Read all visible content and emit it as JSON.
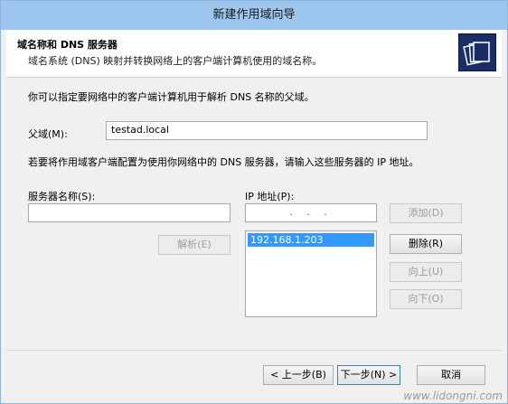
{
  "window": {
    "title": "新建作用域向导"
  },
  "header": {
    "title": "域名称和 DNS 服务器",
    "subtitle": "域名系统 (DNS) 映射并转换网络上的客户端计算机使用的域名称。",
    "icon": "folder-wizard-icon"
  },
  "intro_text": "你可以指定要网络中的客户端计算机用于解析 DNS 名称的父域。",
  "parent_domain": {
    "label": "父域(M):",
    "value": "testad.local"
  },
  "dns_instruction": "若要将作用域客户端配置为使用你网络中的 DNS 服务器，请输入这些服务器的 IP 地址。",
  "server_name": {
    "label": "服务器名称(S):",
    "value": ""
  },
  "resolve_button": "解析(E)",
  "ip": {
    "label": "IP 地址(P):",
    "input_placeholder": ". . .",
    "list": [
      "192.168.1.203"
    ]
  },
  "side_buttons": {
    "add": "添加(D)",
    "remove": "删除(R)",
    "up": "向上(U)",
    "down": "向下(O)"
  },
  "footer": {
    "back": "< 上一步(B)",
    "next": "下一步(N) >",
    "cancel": "取消"
  },
  "watermark": "www.lidongni.com"
}
